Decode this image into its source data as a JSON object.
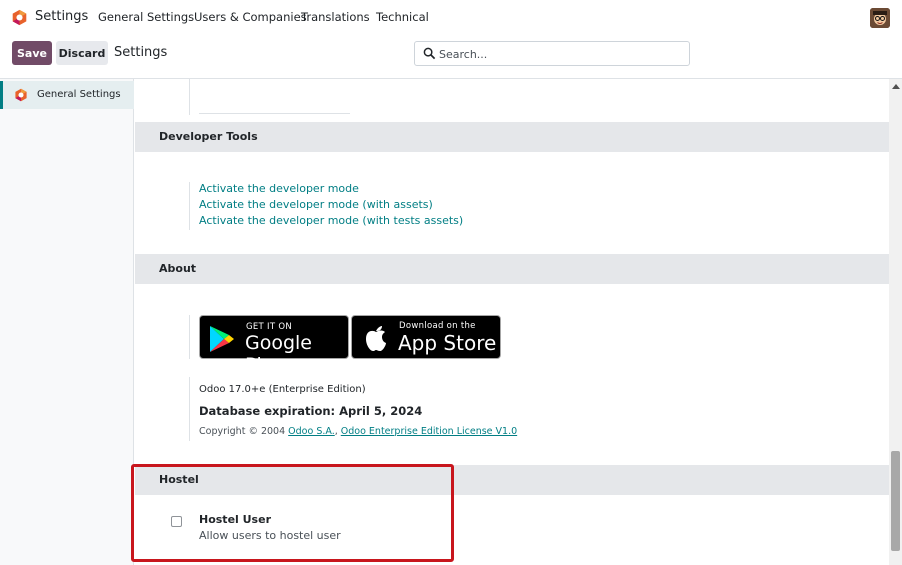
{
  "app": {
    "name": "Settings"
  },
  "menu": [
    "General Settings",
    "Users & Companies",
    "Translations",
    "Technical"
  ],
  "toolbar": {
    "save_label": "Save",
    "discard_label": "Discard",
    "title": "Settings"
  },
  "search": {
    "placeholder": "Search..."
  },
  "sidebar": {
    "items": [
      {
        "label": "General Settings"
      }
    ]
  },
  "sections": {
    "developer": {
      "title": "Developer Tools",
      "links": [
        "Activate the developer mode",
        "Activate the developer mode (with assets)",
        "Activate the developer mode (with tests assets)"
      ]
    },
    "about": {
      "title": "About",
      "google_play": {
        "small": "GET IT ON",
        "big": "Google Play"
      },
      "app_store": {
        "small": "Download on the",
        "big": "App Store"
      },
      "version": "Odoo 17.0+e (Enterprise Edition)",
      "expiration": "Database expiration: April 5, 2024",
      "copyright_prefix": "Copyright © 2004",
      "company_link": "Odoo S.A.",
      "license_link": "Odoo Enterprise Edition License V1.0"
    },
    "hostel": {
      "title": "Hostel",
      "setting_title": "Hostel User",
      "setting_desc": "Allow users to hostel user"
    }
  },
  "colors": {
    "primary": "#714b67",
    "link": "#017e84",
    "highlight": "#c8161d",
    "section_bg": "#e5e7ea"
  }
}
